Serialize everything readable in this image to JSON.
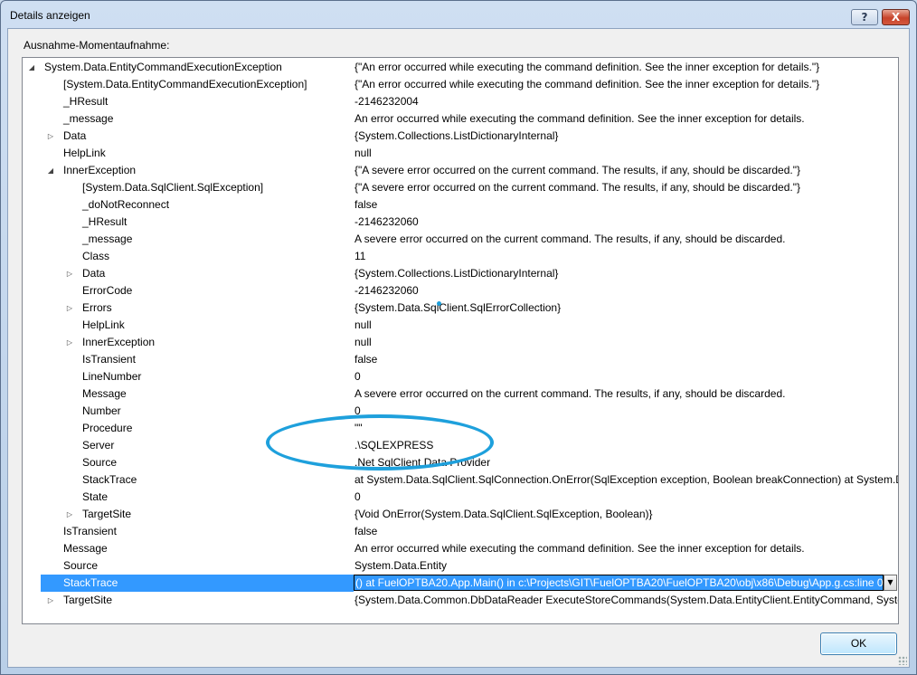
{
  "window": {
    "title": "Details anzeigen",
    "help_label": "?",
    "close_label": "X"
  },
  "section_label": "Ausnahme-Momentaufnahme:",
  "ok_label": "OK",
  "rows": [
    {
      "name": "System.Data.EntityCommandExecutionException",
      "value": "{\"An error occurred while executing the command definition. See the inner exception for details.\"}",
      "expander": "expanded"
    },
    {
      "name": "[System.Data.EntityCommandExecutionException]",
      "value": "{\"An error occurred while executing the command definition. See the inner exception for details.\"}",
      "expander": ""
    },
    {
      "name": "_HResult",
      "value": "-2146232004",
      "expander": ""
    },
    {
      "name": "_message",
      "value": "An error occurred while executing the command definition. See the inner exception for details.",
      "expander": ""
    },
    {
      "name": "Data",
      "value": "{System.Collections.ListDictionaryInternal}",
      "expander": "collapsed"
    },
    {
      "name": "HelpLink",
      "value": "null",
      "expander": ""
    },
    {
      "name": "InnerException",
      "value": "{\"A severe error occurred on the current command.  The results, if any, should be discarded.\"}",
      "expander": "expanded"
    },
    {
      "name": "[System.Data.SqlClient.SqlException]",
      "value": "{\"A severe error occurred on the current command.  The results, if any, should be discarded.\"}",
      "expander": ""
    },
    {
      "name": "_doNotReconnect",
      "value": "false",
      "expander": ""
    },
    {
      "name": "_HResult",
      "value": "-2146232060",
      "expander": ""
    },
    {
      "name": "_message",
      "value": "A severe error occurred on the current command.  The results, if any, should be discarded.",
      "expander": ""
    },
    {
      "name": "Class",
      "value": "11",
      "expander": ""
    },
    {
      "name": "Data",
      "value": "{System.Collections.ListDictionaryInternal}",
      "expander": "collapsed"
    },
    {
      "name": "ErrorCode",
      "value": "-2146232060",
      "expander": ""
    },
    {
      "name": "Errors",
      "value": "{System.Data.SqlClient.SqlErrorCollection}",
      "expander": "collapsed"
    },
    {
      "name": "HelpLink",
      "value": "null",
      "expander": ""
    },
    {
      "name": "InnerException",
      "value": "null",
      "expander": "collapsed"
    },
    {
      "name": "IsTransient",
      "value": "false",
      "expander": ""
    },
    {
      "name": "LineNumber",
      "value": "0",
      "expander": ""
    },
    {
      "name": "Message",
      "value": "A severe error occurred on the current command.  The results, if any, should be discarded.",
      "expander": ""
    },
    {
      "name": "Number",
      "value": "0",
      "expander": ""
    },
    {
      "name": "Procedure",
      "value": "\"\"",
      "expander": ""
    },
    {
      "name": "Server",
      "value": ".\\SQLEXPRESS",
      "expander": ""
    },
    {
      "name": "Source",
      "value": ".Net SqlClient Data Provider",
      "expander": ""
    },
    {
      "name": "StackTrace",
      "value": "  at System.Data.SqlClient.SqlConnection.OnError(SqlException exception, Boolean breakConnection)   at System.Data",
      "expander": ""
    },
    {
      "name": "State",
      "value": "0",
      "expander": ""
    },
    {
      "name": "TargetSite",
      "value": "{Void OnError(System.Data.SqlClient.SqlException, Boolean)}",
      "expander": "collapsed"
    },
    {
      "name": "IsTransient",
      "value": "false",
      "expander": ""
    },
    {
      "name": "Message",
      "value": "An error occurred while executing the command definition. See the inner exception for details.",
      "expander": ""
    },
    {
      "name": "Source",
      "value": "System.Data.Entity",
      "expander": ""
    },
    {
      "name": "StackTrace",
      "value": "()   at FuelOPTBA20.App.Main() in c:\\Projects\\GIT\\FuelOPTBA20\\FuelOPTBA20\\obj\\x86\\Debug\\App.g.cs:line 0",
      "expander": "",
      "selected": true
    },
    {
      "name": "TargetSite",
      "value": "{System.Data.Common.DbDataReader ExecuteStoreCommands(System.Data.EntityClient.EntityCommand, System.Data",
      "expander": "collapsed"
    }
  ],
  "colors": {
    "selection": "#3399ff",
    "annotation": "#1ea0dc"
  }
}
